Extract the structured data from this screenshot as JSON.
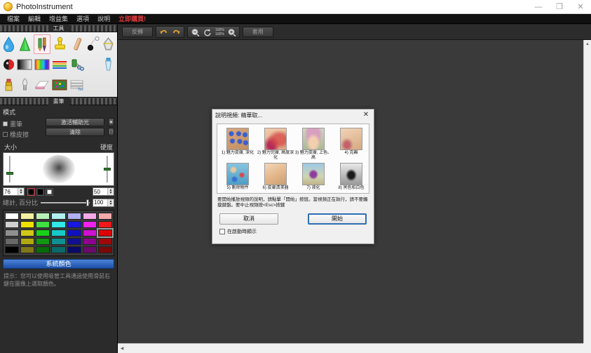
{
  "window": {
    "title": "PhotoInstrument",
    "logo_icon": "app-logo-icon",
    "minimize_label": "—",
    "restore_label": "❐",
    "close_label": "✕"
  },
  "menubar": {
    "items": [
      {
        "label": "檔案",
        "promo": false
      },
      {
        "label": "編輯",
        "promo": false
      },
      {
        "label": "增益集",
        "promo": false
      },
      {
        "label": "選項",
        "promo": false
      },
      {
        "label": "說明",
        "promo": false
      },
      {
        "label": "立即購買!",
        "promo": true
      }
    ]
  },
  "tools_panel": {
    "header": "工具",
    "tools": [
      {
        "name": "water-drop-tool-icon",
        "label": "液滴"
      },
      {
        "name": "clone-cone-tool-icon",
        "label": "克隆"
      },
      {
        "name": "brush-pencil-tool-icon",
        "label": "畫筆",
        "selected": true
      },
      {
        "name": "stamp-tool-icon",
        "label": "圖章"
      },
      {
        "name": "blur-stick-tool-icon",
        "label": "模糊"
      },
      {
        "name": "liquify-tool-icon",
        "label": "液化"
      },
      {
        "name": "patch-tool-icon",
        "label": "修補"
      },
      {
        "name": "red-eye-tool-icon",
        "label": "紅眼"
      },
      {
        "name": "gradient-tool-icon",
        "label": "漸層"
      },
      {
        "name": "rainbow-colorize-tool-icon",
        "label": "色彩"
      },
      {
        "name": "color-lines-tool-icon",
        "label": "色線"
      },
      {
        "name": "scissors-cut-tool-icon",
        "label": "剪切"
      },
      {
        "name": "spray-tool-icon",
        "label": "噴漆"
      },
      {
        "name": "lipstick-tool-icon",
        "label": "口紅"
      },
      {
        "name": "lamp-tool-icon",
        "label": "燈光"
      },
      {
        "name": "eraser-tool-icon",
        "label": "橡皮擦"
      },
      {
        "name": "texture-tool-icon",
        "label": "紋理"
      },
      {
        "name": "layers-text-tool-icon",
        "label": "圖層"
      }
    ]
  },
  "brush_panel": {
    "header": "畫筆",
    "mode_label": "模式",
    "mode_options": [
      {
        "label": "畫筆",
        "selected": true
      },
      {
        "label": "橡皮擦",
        "selected": false
      }
    ],
    "buttons": [
      {
        "label": "激活輔助光"
      },
      {
        "label": "清除"
      }
    ],
    "size_label": "大小",
    "size_value": "76",
    "hardness_label": "硬度",
    "hardness_value": "50",
    "opacity_label": "總計, 百分比",
    "opacity_value": "100",
    "shape_swatches": [
      {
        "name": "round-brush-swatch",
        "shape": "circle",
        "selected": true
      },
      {
        "name": "square-brush-swatch",
        "shape": "square",
        "selected": false
      },
      {
        "name": "empty-brush-swatch",
        "shape": "empty",
        "selected": false
      }
    ]
  },
  "palette": {
    "system_color_button": "系統顏色",
    "selected_index": 20,
    "colors": [
      "#ffffff",
      "#f5f0a0",
      "#b8f0b8",
      "#b0f0f0",
      "#b0b0f5",
      "#f5a8e8",
      "#f5a8a8",
      "#d0d0d0",
      "#f0e000",
      "#40e040",
      "#30e8e8",
      "#1818e0",
      "#f020f0",
      "#f01818",
      "#909090",
      "#d0c818",
      "#18d018",
      "#18c8c8",
      "#1010c0",
      "#d010d0",
      "#e00000",
      "#686868",
      "#b0a810",
      "#109810",
      "#109090",
      "#101090",
      "#900090",
      "#a00808",
      "#000000",
      "#807818",
      "#0a6a0a",
      "#0a6a6a",
      "#0a0a6a",
      "#6a0a6a",
      "#7a0808"
    ],
    "tip": "提示：您可以使用吸管工具通過使用滑鼠右鍵在圖像上選取顏色。"
  },
  "canvas_toolbar": {
    "reset_label": "反轉",
    "apply_label": "套用",
    "undo_icon": "undo-arrow-icon",
    "redo_icon": "redo-arrow-icon",
    "zoom_out_icon": "zoom-out-icon",
    "zoom_reset_icon": "zoom-reset-icon",
    "zoom_in_icon": "zoom-in-icon",
    "zoom_value_current": "100%",
    "zoom_value_fit": "100%"
  },
  "dialog": {
    "title": "說明視頻: 精華取...",
    "close_icon": "close-icon",
    "thumbnails": [
      {
        "index": "1)",
        "label": "魅力皮膚, 深化",
        "art": "skin-dots"
      },
      {
        "index": "2)",
        "label": "魅力完膚, 高度深化",
        "art": "face-blush"
      },
      {
        "index": "3)",
        "label": "魅力皮膚, 上色、高",
        "art": "portrait-hair"
      },
      {
        "index": "4)",
        "label": "克難",
        "art": "skin-smooth"
      },
      {
        "index": "5)",
        "label": "刪除物件",
        "art": "beach-scene"
      },
      {
        "index": "6)",
        "label": "皮膚清潔器",
        "art": "skin-clean"
      },
      {
        "index": "7)",
        "label": "液化",
        "art": "figure-purple"
      },
      {
        "index": "8)",
        "label": "黑色和白色",
        "art": "figure-bw"
      }
    ],
    "description": "要開始播放視頻的說明，請點擊「開始」按鈕。當視頻正在執行，請不要觸摸鍵盤。要中止視頻按<Esc>按鍵",
    "cancel_label": "取消",
    "start_label": "開始",
    "checkbox_label": "在啟動時顯示",
    "checkbox_checked": false
  },
  "scrollbars": {
    "up_arrow": "▲",
    "down_arrow": "▼",
    "left_arrow": "◀",
    "right_arrow": "▶"
  },
  "colors": {
    "accent_blue": "#2f6fb5",
    "promo_red": "#e03a3a",
    "panel_dark": "#2b2b2b",
    "canvas_bg": "#3a3a3a"
  }
}
